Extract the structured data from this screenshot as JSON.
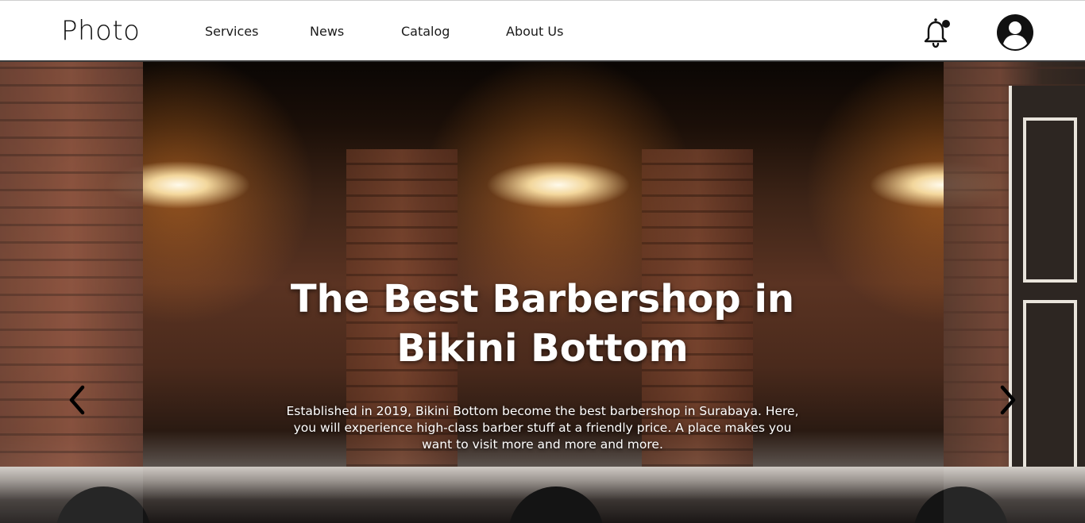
{
  "header": {
    "brand": "Photo",
    "nav": {
      "services": "Services",
      "news": "News",
      "catalog": "Catalog",
      "about": "About Us"
    },
    "icons": {
      "notification": "bell-icon",
      "profile": "user-avatar-icon"
    }
  },
  "hero": {
    "title_line1": "The Best Barbershop in",
    "title_line2": "Bikini Bottom",
    "description": "Established in 2019, Bikini Bottom become the best barbershop in Surabaya. Here, you will experience high-class barber stuff at a friendly price. A place makes you want to visit more and more and more.",
    "prev_icon": "chevron-left-icon",
    "next_icon": "chevron-right-icon"
  },
  "colors": {
    "header_bg": "#ffffff",
    "text_dark": "#111111",
    "hero_text": "#ffffff"
  }
}
